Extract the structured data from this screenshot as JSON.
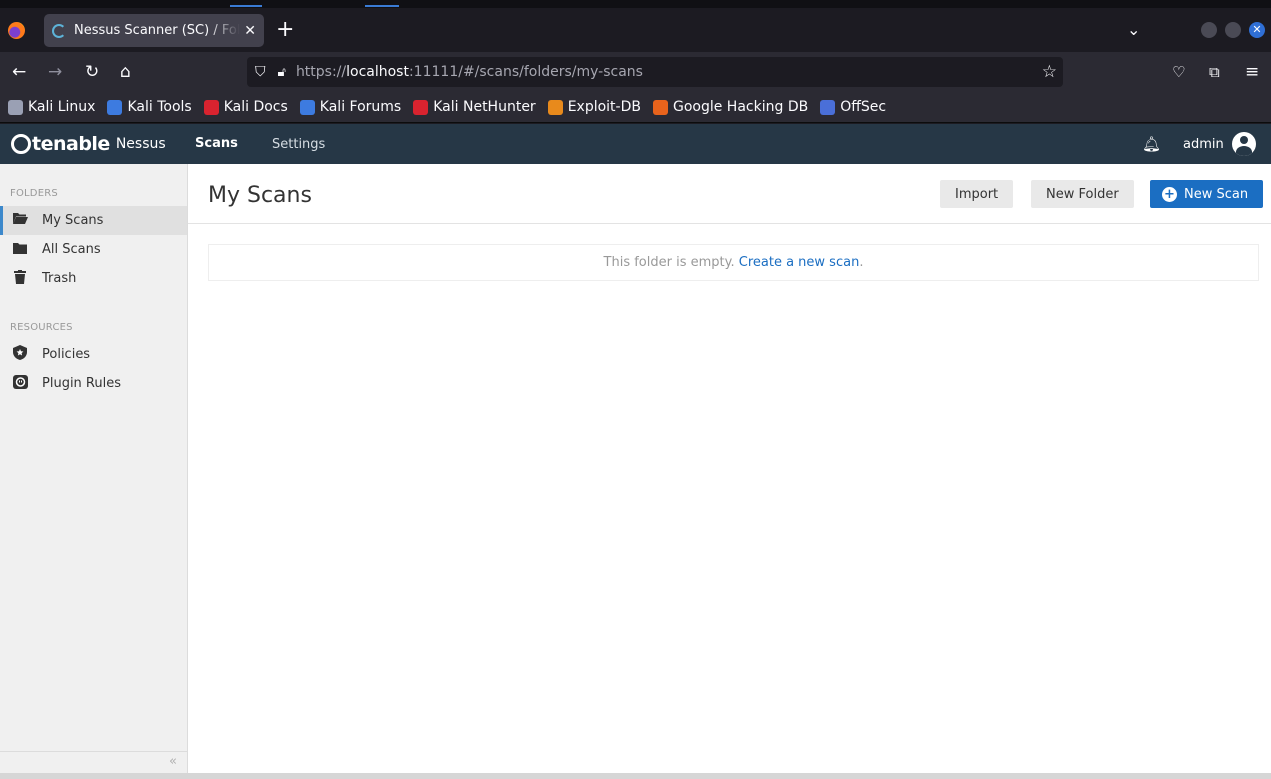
{
  "browser": {
    "tab_title": "Nessus Scanner (SC) / Folders / My Scans",
    "url_prefix": "https://",
    "url_host": "localhost",
    "url_rest": ":11111/#/scans/folders/my-scans",
    "bookmarks": [
      {
        "label": "Kali Linux",
        "icon": "kali-dragon-icon",
        "color": "#9aa0b4"
      },
      {
        "label": "Kali Tools",
        "icon": "kali-tools-icon",
        "color": "#3d7be0"
      },
      {
        "label": "Kali Docs",
        "icon": "kali-docs-icon",
        "color": "#d9232f"
      },
      {
        "label": "Kali Forums",
        "icon": "kali-forums-icon",
        "color": "#3d7be0"
      },
      {
        "label": "Kali NetHunter",
        "icon": "nethunter-icon",
        "color": "#d9232f"
      },
      {
        "label": "Exploit-DB",
        "icon": "exploit-db-icon",
        "color": "#e88a1c"
      },
      {
        "label": "Google Hacking DB",
        "icon": "ghdb-icon",
        "color": "#e8631c"
      },
      {
        "label": "OffSec",
        "icon": "offsec-icon",
        "color": "#4a6fd8"
      }
    ]
  },
  "header": {
    "brand": "tenable",
    "product": "Nessus",
    "nav_scans": "Scans",
    "nav_settings": "Settings",
    "username": "admin"
  },
  "sidebar": {
    "folders_heading": "FOLDERS",
    "folders": [
      {
        "label": "My Scans",
        "icon": "folder-open-icon",
        "active": true
      },
      {
        "label": "All Scans",
        "icon": "folder-icon",
        "active": false
      },
      {
        "label": "Trash",
        "icon": "trash-icon",
        "active": false
      }
    ],
    "resources_heading": "RESOURCES",
    "resources": [
      {
        "label": "Policies",
        "icon": "policy-shield-icon"
      },
      {
        "label": "Plugin Rules",
        "icon": "plugin-rules-icon"
      }
    ],
    "collapse_glyph": "«"
  },
  "main": {
    "title": "My Scans",
    "import_label": "Import",
    "new_folder_label": "New Folder",
    "new_scan_label": "New Scan",
    "empty_text": "This folder is empty.",
    "empty_link": "Create a new scan",
    "empty_end": "."
  },
  "colors": {
    "header_bg": "#263746",
    "primary": "#1b6ec2",
    "active_accent": "#3c88cb"
  }
}
